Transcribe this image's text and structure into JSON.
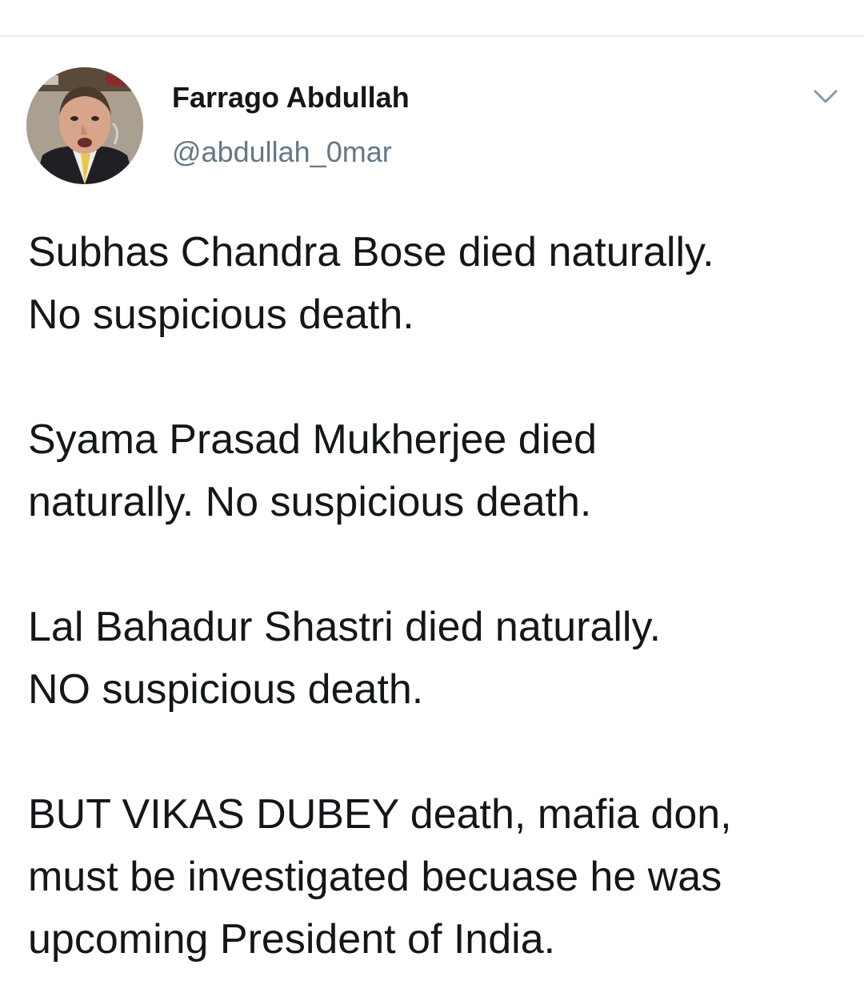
{
  "tweet": {
    "author": {
      "display_name": "Farrago Abdullah",
      "handle": "@abdullah_0mar",
      "avatar_icon": "profile-photo-icon"
    },
    "menu_icon": "chevron-down-icon",
    "paragraphs": [
      "Subhas Chandra Bose died naturally.\nNo suspicious death.",
      "Syama Prasad Mukherjee died\nnaturally. No suspicious death.",
      "Lal Bahadur Shastri died naturally.\nNO suspicious death.",
      "BUT VIKAS DUBEY death, mafia don,\nmust be investigated becuase he was\nupcoming President of India."
    ]
  },
  "colors": {
    "text_primary": "#14171a",
    "text_secondary": "#657786",
    "divider": "#e6ecf0",
    "background": "#ffffff"
  }
}
